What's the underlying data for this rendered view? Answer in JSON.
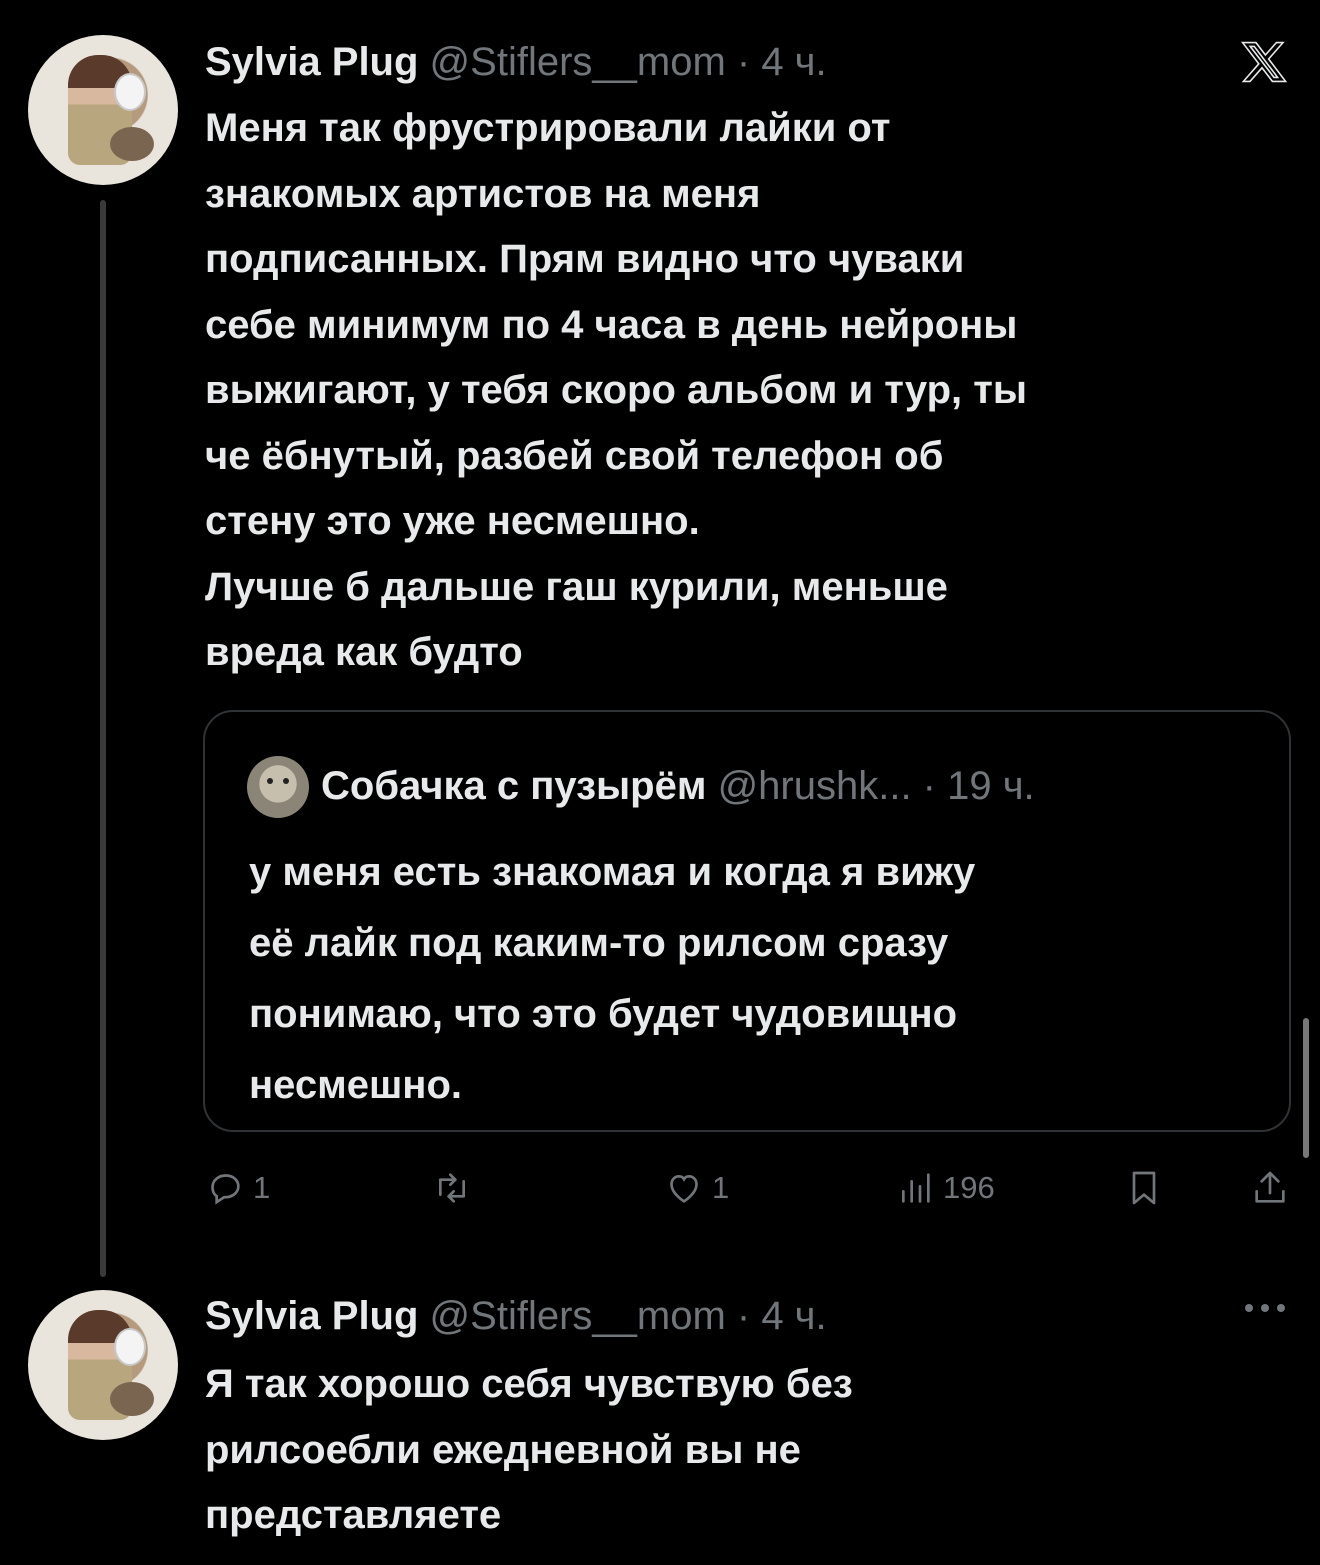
{
  "tweet1": {
    "author_name": "Sylvia Plug",
    "meta": "@Stiflers__mom · 4 ч.",
    "lines": [
      "Меня так фрустрировали лайки от",
      "знакомых артистов на меня",
      "подписанных. Прям видно что чуваки",
      "себе минимум по 4 часа в день нейроны",
      "выжигают, у тебя скоро альбом и тур, ты",
      "че ёбнутый, разбей свой телефон об",
      "стену это уже несмешно.",
      "Лучше б дальше гаш курили, меньше",
      "вреда как будто"
    ],
    "quote": {
      "author_name": "Собачка с пузырём",
      "meta": "@hrushk... · 19 ч.",
      "lines": [
        "у меня есть знакомая и когда я вижу",
        "её лайк под каким-то  рилсом сразу",
        "понимаю, что это будет чудовищно",
        "несмешно."
      ]
    },
    "actions": {
      "reply_count": "1",
      "repost_count": "",
      "like_count": "1",
      "views_count": "196"
    }
  },
  "tweet2": {
    "author_name": "Sylvia Plug",
    "meta": "@Stiflers__mom · 4 ч.",
    "lines": [
      "Я так хорошо себя чувствую без",
      "рилсоебли ежедневной вы не",
      "представляете"
    ]
  },
  "icons": {
    "close": "x-logo-icon",
    "reply": "reply-icon",
    "repost": "repost-icon",
    "like": "heart-icon",
    "views": "views-icon",
    "bookmark": "bookmark-icon",
    "share": "share-icon",
    "more": "more-icon"
  },
  "colors": {
    "background": "#000000",
    "text": "#e7e9ea",
    "secondary": "#71767b",
    "border": "#2f3336"
  }
}
